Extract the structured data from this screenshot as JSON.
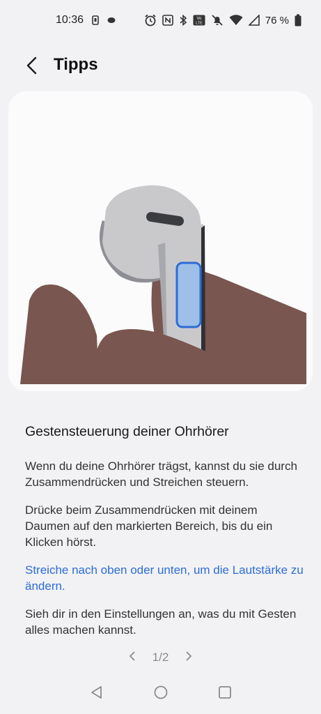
{
  "status_bar": {
    "time": "10:36",
    "battery_percent": "76 %",
    "icons": [
      "phone-icon",
      "dot-icon",
      "alarm-icon",
      "nfc-icon",
      "bluetooth-icon",
      "volte-icon",
      "mute-icon",
      "wifi-icon",
      "signal-icon",
      "battery-icon"
    ]
  },
  "header": {
    "title": "Tipps",
    "back_icon": "back-arrow-icon"
  },
  "illustration": {
    "description_icon": "earbud-illustration",
    "colors": {
      "earbud": "#c9c9cc",
      "earbud_dark": "#8e8f94",
      "hand": "#7a5650",
      "touch_area": "#9dbfe8",
      "touch_border": "#2d6cd6",
      "accent": "#f07a2a"
    }
  },
  "tip": {
    "heading": "Gestensteuerung deiner Ohrhörer",
    "paragraphs": [
      "Wenn du deine Ohrhörer trägst, kannst du sie durch Zusammendrücken und Streichen steuern.",
      "Drücke beim Zusammendrücken mit deinem Daumen auf den markierten Bereich, bis du ein Klicken hörst."
    ],
    "link": "Streiche nach oben oder unten, um die Lautstärke zu ändern.",
    "last_paragraph": "Sieh dir in den Einstellungen an, was du mit Gesten alles machen kannst."
  },
  "pager": {
    "label": "1/2",
    "prev_icon": "chevron-left-icon",
    "next_icon": "chevron-right-icon"
  },
  "nav_bar": {
    "icons": [
      "nav-back-icon",
      "nav-home-icon",
      "nav-recents-icon"
    ]
  }
}
